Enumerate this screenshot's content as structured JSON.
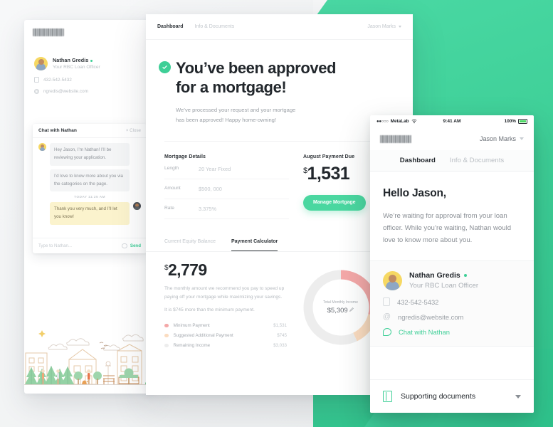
{
  "brand": {
    "accent_green": "#3ecf97",
    "cta_green": "#4ad7a0",
    "pink": "#f4a8a8",
    "peach": "#fbdcc0",
    "gray": "#ededed"
  },
  "desktop": {
    "logo_alt": "company-logo",
    "nav": {
      "tabs": [
        {
          "label": "Dashboard",
          "active": true
        },
        {
          "label": "Info & Documents",
          "active": false
        }
      ],
      "user": "Jason Marks"
    },
    "hero": {
      "status_icon": "check-circle-icon",
      "title_line1": "You’ve been approved",
      "title_line2": "for a mortgage!",
      "sub_line1": "We’ve processed your request and your mortgage",
      "sub_line2": "has been approved! Happy home-owning!"
    },
    "mortgage_details": {
      "title": "Mortgage Details",
      "rows": [
        {
          "key": "Length",
          "value": "20 Year Fixed"
        },
        {
          "key": "Amount",
          "value": "$500, 000"
        },
        {
          "key": "Rate",
          "value": "3.375%"
        }
      ]
    },
    "payment_due": {
      "title": "August Payment Due",
      "currency": "$",
      "amount": "1,531",
      "cta": "Manage Mortgage"
    },
    "calculator": {
      "tabs": [
        {
          "label": "Current Equity Balance",
          "active": false
        },
        {
          "label": "Payment Calculator",
          "active": true
        }
      ],
      "currency": "$",
      "amount": "2,779",
      "description": "The monthly amount we recommend you pay to speed up paying off your mortgage while maximizing your savings.",
      "note": "It is $745 more than the minimum payment."
    }
  },
  "chart_data": {
    "type": "pie",
    "title": "Total Monthly Income",
    "center_value": "$5,309",
    "center_label": "Total Monthly Income",
    "edit_icon": "pencil-icon",
    "categories": [
      "Minimum Payment",
      "Suggested Additional Payment",
      "Remaining Income"
    ],
    "values": [
      1531,
      745,
      3033
    ],
    "value_labels": [
      "$1,531",
      "$745",
      "$3,033"
    ],
    "colors": [
      "#f4a8a8",
      "#fbdcc0",
      "#ededed"
    ],
    "total": 5309,
    "legend_position": "left",
    "grid": false
  },
  "chat_panel": {
    "officer": {
      "name": "Nathan Gredis",
      "status_icon": "online-dot-icon",
      "role": "Your RBC Loan Officer",
      "phone_icon": "phone-icon",
      "phone": "432-542-5432",
      "email_icon": "at-icon",
      "email": "ngredis@website.com"
    },
    "header_title": "Chat with Nathan",
    "close_label": "× Close",
    "messages": [
      {
        "from": "them",
        "text": "Hey Jason, I’m Nathan! I’ll be reviewing your application."
      },
      {
        "from": "them",
        "text": "I’d love to know more about you via the categories on the page."
      },
      {
        "from": "me",
        "text": "Thank you very much, and I’ll let you know!"
      }
    ],
    "timestamp": "TODAY  11:25 AM",
    "input_placeholder": "Type to Nathan...",
    "emoji_icon": "emoji-icon",
    "send_label": "Send"
  },
  "phone": {
    "statusbar": {
      "dots": "●●○○○",
      "carrier": "MetaLab",
      "wifi_icon": "wifi-icon",
      "time": "9:41 AM",
      "battery_pct": "100%",
      "battery_icon": "battery-icon"
    },
    "logo_alt": "company-logo",
    "user": "Jason Marks",
    "tabs": [
      {
        "label": "Dashboard",
        "active": true
      },
      {
        "label": "Info & Documents",
        "active": false
      }
    ],
    "greeting": "Hello Jason,",
    "body": "We’re waiting for approval from your loan officer. While you’re waiting, Nathan would love to know more about you.",
    "officer": {
      "name": "Nathan Gredis",
      "role": "Your RBC Loan Officer",
      "phone": "432-542-5432",
      "email": "ngredis@website.com",
      "chat_link": "Chat with Nathan"
    },
    "footer": {
      "icon": "documents-icon",
      "label": "Supporting documents",
      "chevron": "chevron-down-icon"
    }
  }
}
